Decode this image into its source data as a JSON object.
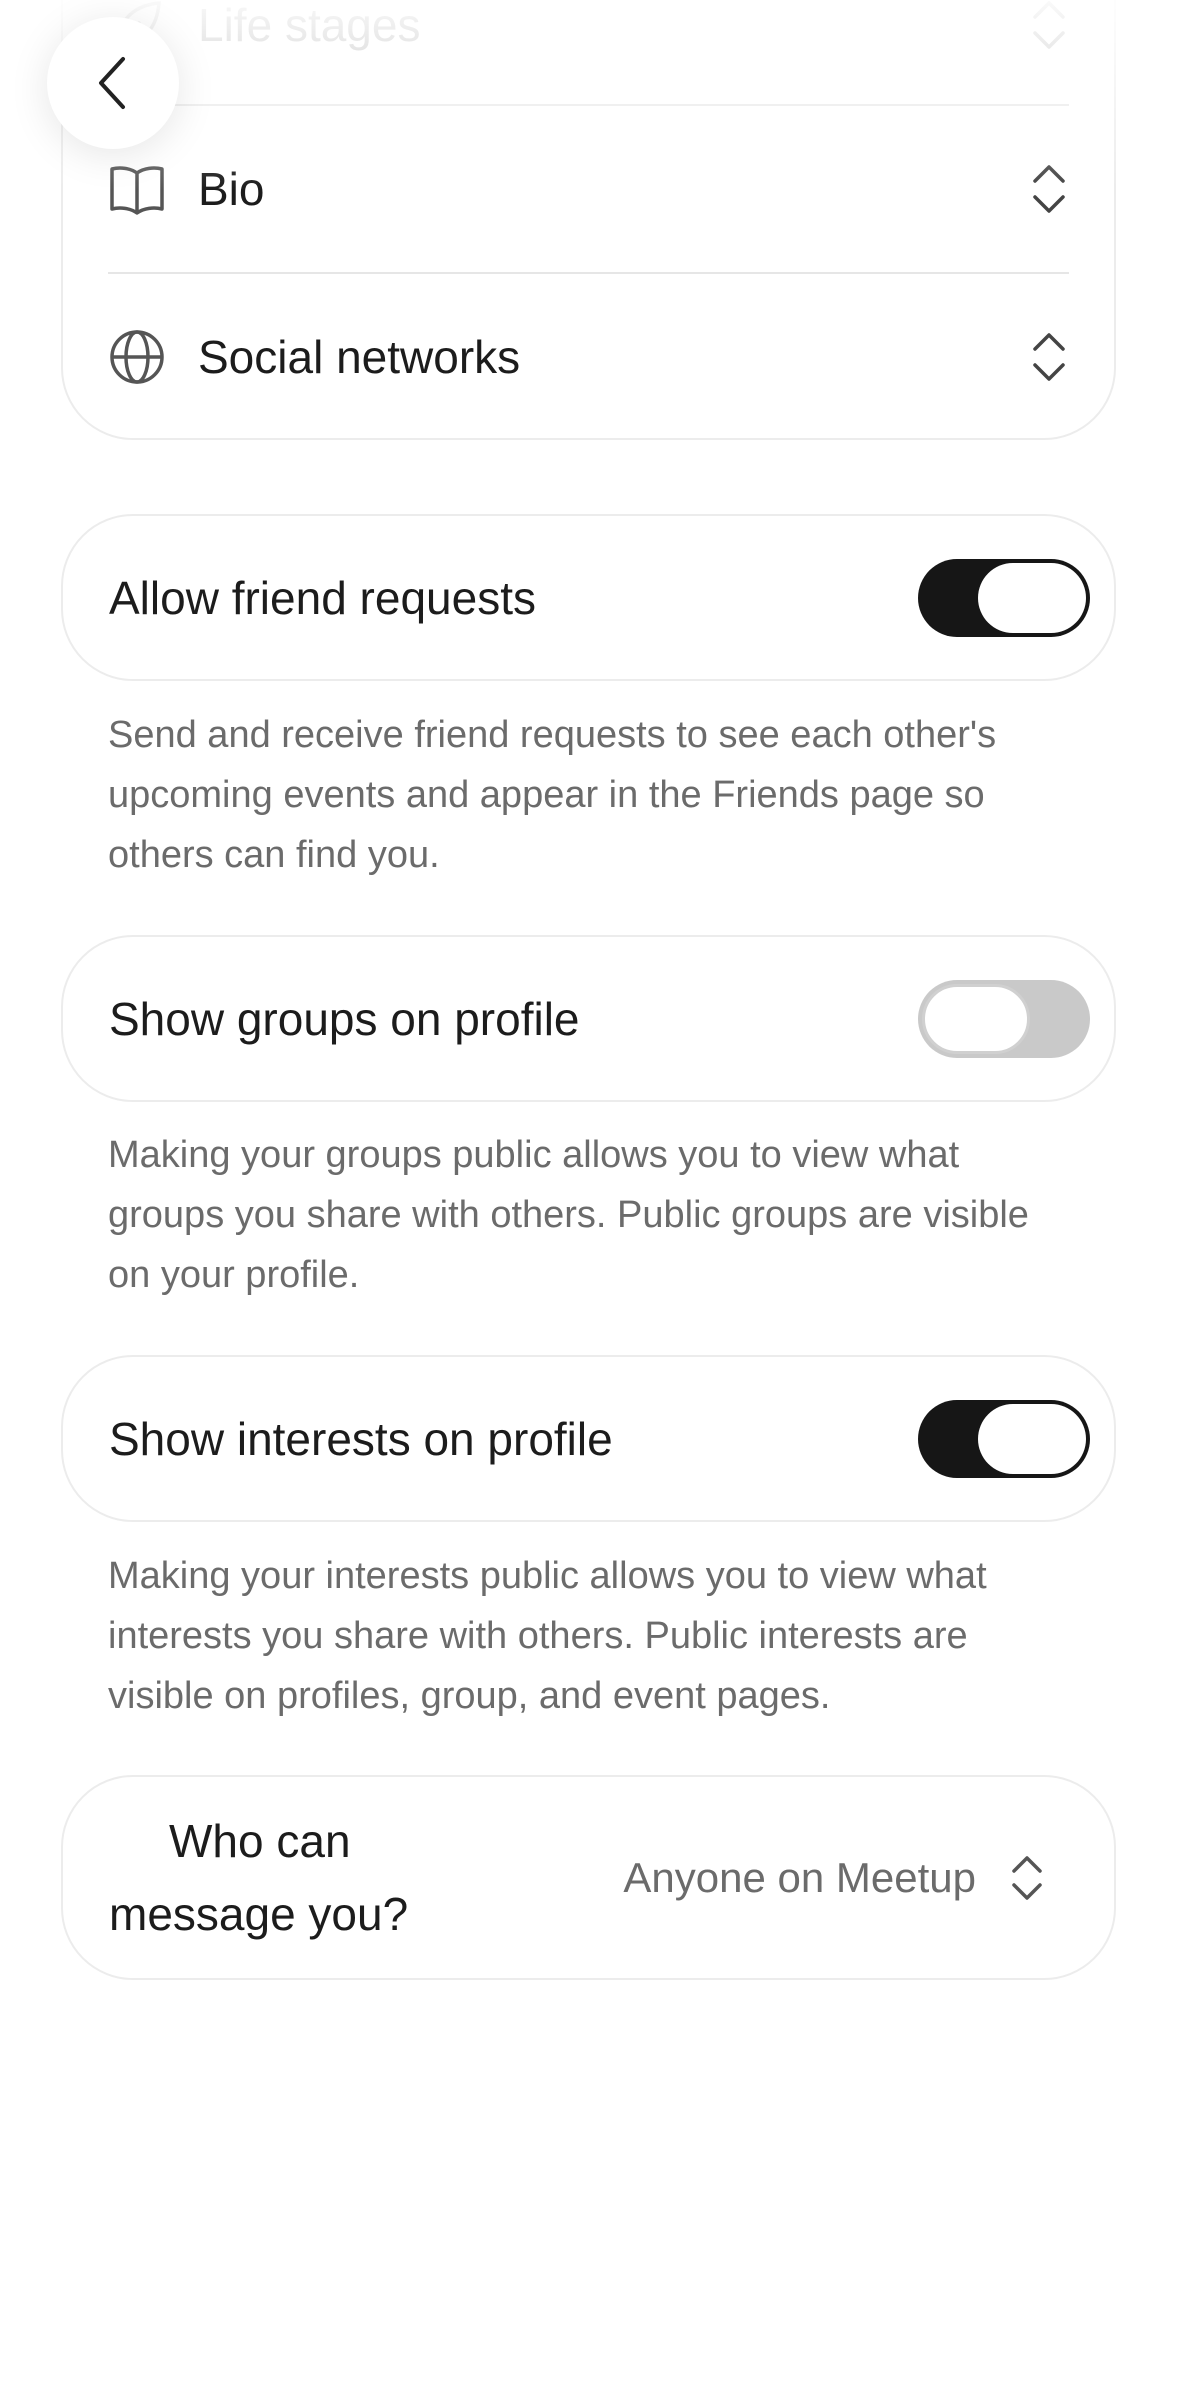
{
  "profile_sections": [
    {
      "label": "Life stages",
      "icon": "leaf-icon"
    },
    {
      "label": "Bio",
      "icon": "book-icon"
    },
    {
      "label": "Social networks",
      "icon": "globe-icon"
    }
  ],
  "settings": [
    {
      "label": "Allow friend requests",
      "enabled": true,
      "description": "Send and receive friend requests to see each other's upcoming events and appear in the Friends page so others can find you."
    },
    {
      "label": "Show groups on profile",
      "enabled": false,
      "description": "Making your groups public allows you to view what groups you share with others. Public groups are visible on your profile."
    },
    {
      "label": "Show interests on profile",
      "enabled": true,
      "description": "Making your interests public allows you to view what interests you share with others. Public interests are visible on profiles, group, and event pages."
    }
  ],
  "messaging": {
    "label_line1": "Who can",
    "label_line2": "message you?",
    "value": "Anyone on Meetup"
  },
  "colors": {
    "toggle_on": "#161616",
    "toggle_off": "#c9c9c9",
    "text": "#1c1c1c",
    "muted": "#6b6b6b"
  }
}
